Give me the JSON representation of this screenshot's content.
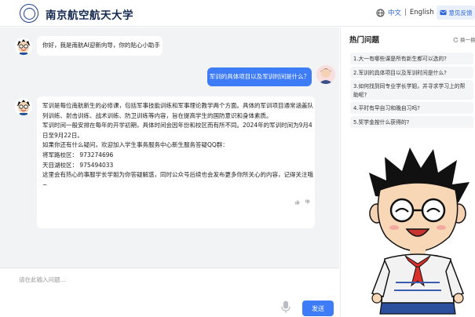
{
  "header": {
    "brand": "南京航空航天大学",
    "lang_cn": "中文",
    "lang_sep": "|",
    "lang_en": "English",
    "feedback": "意见反馈"
  },
  "chat": {
    "greeting": "你好，我是南航AI迎新向导，你的贴心小助手",
    "user_question": "军训的具体项目以及军训时间是什么？",
    "answer_lines": [
      "军训是每位南航新生的必修课，包括军事技能训练和军事理论教学两个方面。具体的军训项目通常涵盖队",
      "列训练、射击训练、战术训练、防卫训练等内容，旨在提高学生的国防意识和身体素质。",
      "军训时间一般安排在每年的开学初期，具体时间会因年份和校区而有所不同。2024年的军训时间为9月4",
      "日至9月22日。",
      "如果你还有什么疑问，欢迎加入学生事务服务中心新生服务答疑QQ群：",
      "将军路校区：  973274696",
      "天目湖校区：  975494033",
      "这里会有热心的事服学长学姐为你答疑解惑，同时公众号后续也会发布更多你所关心的内容，记得关注哦",
      "~"
    ]
  },
  "input": {
    "placeholder": "请在此输入问题...",
    "send_label": "发送"
  },
  "panel": {
    "title": "热门问题",
    "refresh": "换一换",
    "questions": [
      "1.大一有哪些课是所有新生都可以选的?",
      "2.军训的具体项目以及军训时间是什么?",
      "3.如何找到同专业学长学姐，并寻求学习上的帮助呢?",
      "4.平时有早自习和晚自习吗?",
      "5.奖学金按什么获得的?"
    ]
  },
  "colors": {
    "accent": "#3d7bf7",
    "brand": "#13284f",
    "chat_bg": "#f2f3f5"
  }
}
